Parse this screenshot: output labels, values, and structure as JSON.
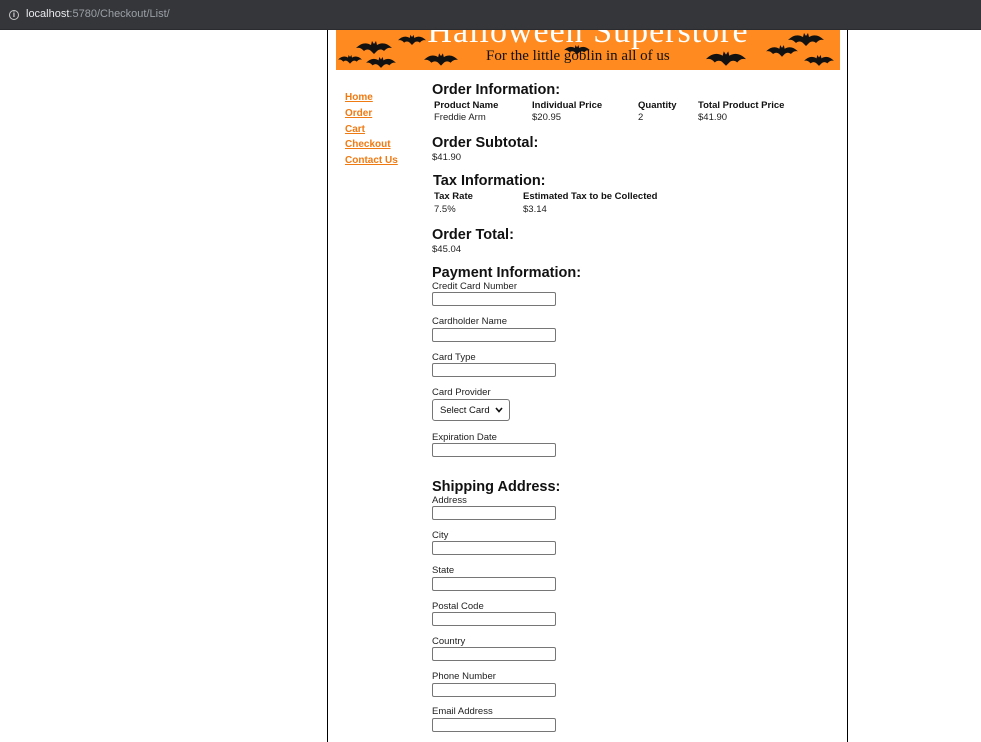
{
  "browser": {
    "url_host": "localhost",
    "url_rest": ":5780/Checkout/List/"
  },
  "banner": {
    "title": "Halloween Superstore",
    "tagline": "For the little goblin in all of us"
  },
  "nav": {
    "items": [
      "Home",
      "Order",
      "Cart",
      "Checkout",
      "Contact Us"
    ]
  },
  "order_info": {
    "heading": "Order Information:",
    "columns": [
      "Product Name",
      "Individual Price",
      "Quantity",
      "Total Product Price"
    ],
    "rows": [
      [
        "Freddie Arm",
        "$20.95",
        "2",
        "$41.90"
      ]
    ]
  },
  "subtotal": {
    "heading": "Order Subtotal:",
    "value": "$41.90"
  },
  "tax": {
    "heading": "Tax Information:",
    "columns": [
      "Tax Rate",
      "Estimated Tax to be Collected"
    ],
    "values": [
      "7.5%",
      "$3.14"
    ]
  },
  "total": {
    "heading": "Order Total:",
    "value": "$45.04"
  },
  "payment": {
    "heading": "Payment Information:",
    "credit_card_label": "Credit Card Number",
    "cardholder_label": "Cardholder Name",
    "card_type_label": "Card Type",
    "card_provider_label": "Card Provider",
    "card_provider_selected": "Select Card",
    "expiration_label": "Expiration Date"
  },
  "shipping": {
    "heading": "Shipping Address:",
    "address_label": "Address",
    "city_label": "City",
    "state_label": "State",
    "postal_label": "Postal Code",
    "country_label": "Country",
    "phone_label": "Phone Number",
    "email_label": "Email Address"
  },
  "colors": {
    "banner_orange": "#ff8a1f",
    "nav_link": "#f07a12",
    "browser_bar": "#35363a"
  }
}
